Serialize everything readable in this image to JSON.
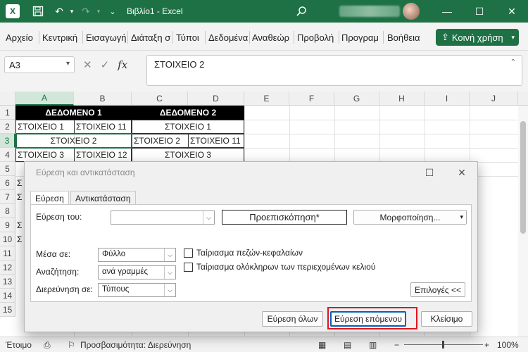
{
  "titlebar": {
    "window_title": "Βιβλίο1  -  Excel",
    "icons": [
      "excel-logo-icon",
      "save-icon",
      "undo-icon",
      "undo-dropdown-icon",
      "redo-icon",
      "redo-dropdown-icon",
      "customize-qat-icon",
      "search-icon",
      "minimize-icon",
      "maximize-icon",
      "close-icon"
    ]
  },
  "ribbon": {
    "tabs": [
      "Αρχείο",
      "Κεντρική",
      "Εισαγωγή",
      "Διάταξη σ",
      "Τύποι",
      "Δεδομένα",
      "Αναθεώρ",
      "Προβολή",
      "Προγραμ",
      "Βοήθεια"
    ],
    "share": "Κοινή χρήση"
  },
  "formula_bar": {
    "name_box": "A3",
    "formula": "ΣΤΟΙΧΕΙΟ 2"
  },
  "grid": {
    "columns": [
      "A",
      "B",
      "C",
      "D",
      "E",
      "F",
      "G",
      "H",
      "I",
      "J"
    ],
    "rows": [
      "1",
      "2",
      "3",
      "4",
      "5",
      "6",
      "7",
      "8",
      "9",
      "10",
      "11",
      "12",
      "13",
      "14",
      "15"
    ],
    "row_stubs": [
      "Σ",
      "Σ",
      "Σ",
      "Σ"
    ],
    "cells": {
      "a1": "ΔΕΔΟΜΕΝΟ 1",
      "c1": "ΔΕΔΟΜΕΝΟ 2",
      "a2": "ΣΤΟΙΧΕΙΟ 1",
      "b2": "ΣΤΟΙΧΕΙΟ 11",
      "c2": "ΣΤΟΙΧΕΙΟ 1",
      "a3": "ΣΤΟΙΧΕΙΟ 2",
      "c3": "ΣΤΟΙΧΕΙΟ 2",
      "d3": "ΣΤΟΙΧΕΙΟ 11",
      "a4": "ΣΤΟΙΧΕΙΟ 3",
      "b4": "ΣΤΟΙΧΕΙΟ 12",
      "c4": "ΣΤΟΙΧΕΙΟ 3"
    }
  },
  "status": {
    "ready": "Έτοιμο",
    "accessibility": "Προσβασιμότητα: Διερεύνηση",
    "zoom": "100%"
  },
  "dialog": {
    "title": "Εύρεση και αντικατάσταση",
    "tab_find": "Εύρεση",
    "tab_replace": "Αντικατάσταση",
    "find_label": "Εύρεση του:",
    "find_value": "",
    "preview": "Προεπισκόπηση*",
    "format_btn": "Μορφοποίηση...",
    "within_label": "Μέσα σε:",
    "within_value": "Φύλλο",
    "search_label": "Αναζήτηση:",
    "search_value": "ανά γραμμές",
    "lookin_label": "Διερεύνηση σε:",
    "lookin_value": "Τύπους",
    "match_case": "Ταίριασμα πεζών-κεφαλαίων",
    "match_entire": "Ταίριασμα ολόκληρων των περιεχομένων κελιού",
    "options_btn": "Επιλογές <<",
    "find_all": "Εύρεση όλων",
    "find_next": "Εύρεση επόμενου",
    "close": "Κλείσιμο"
  },
  "colors": {
    "excel_green": "#1e7145",
    "highlight_red": "#e0151c"
  }
}
